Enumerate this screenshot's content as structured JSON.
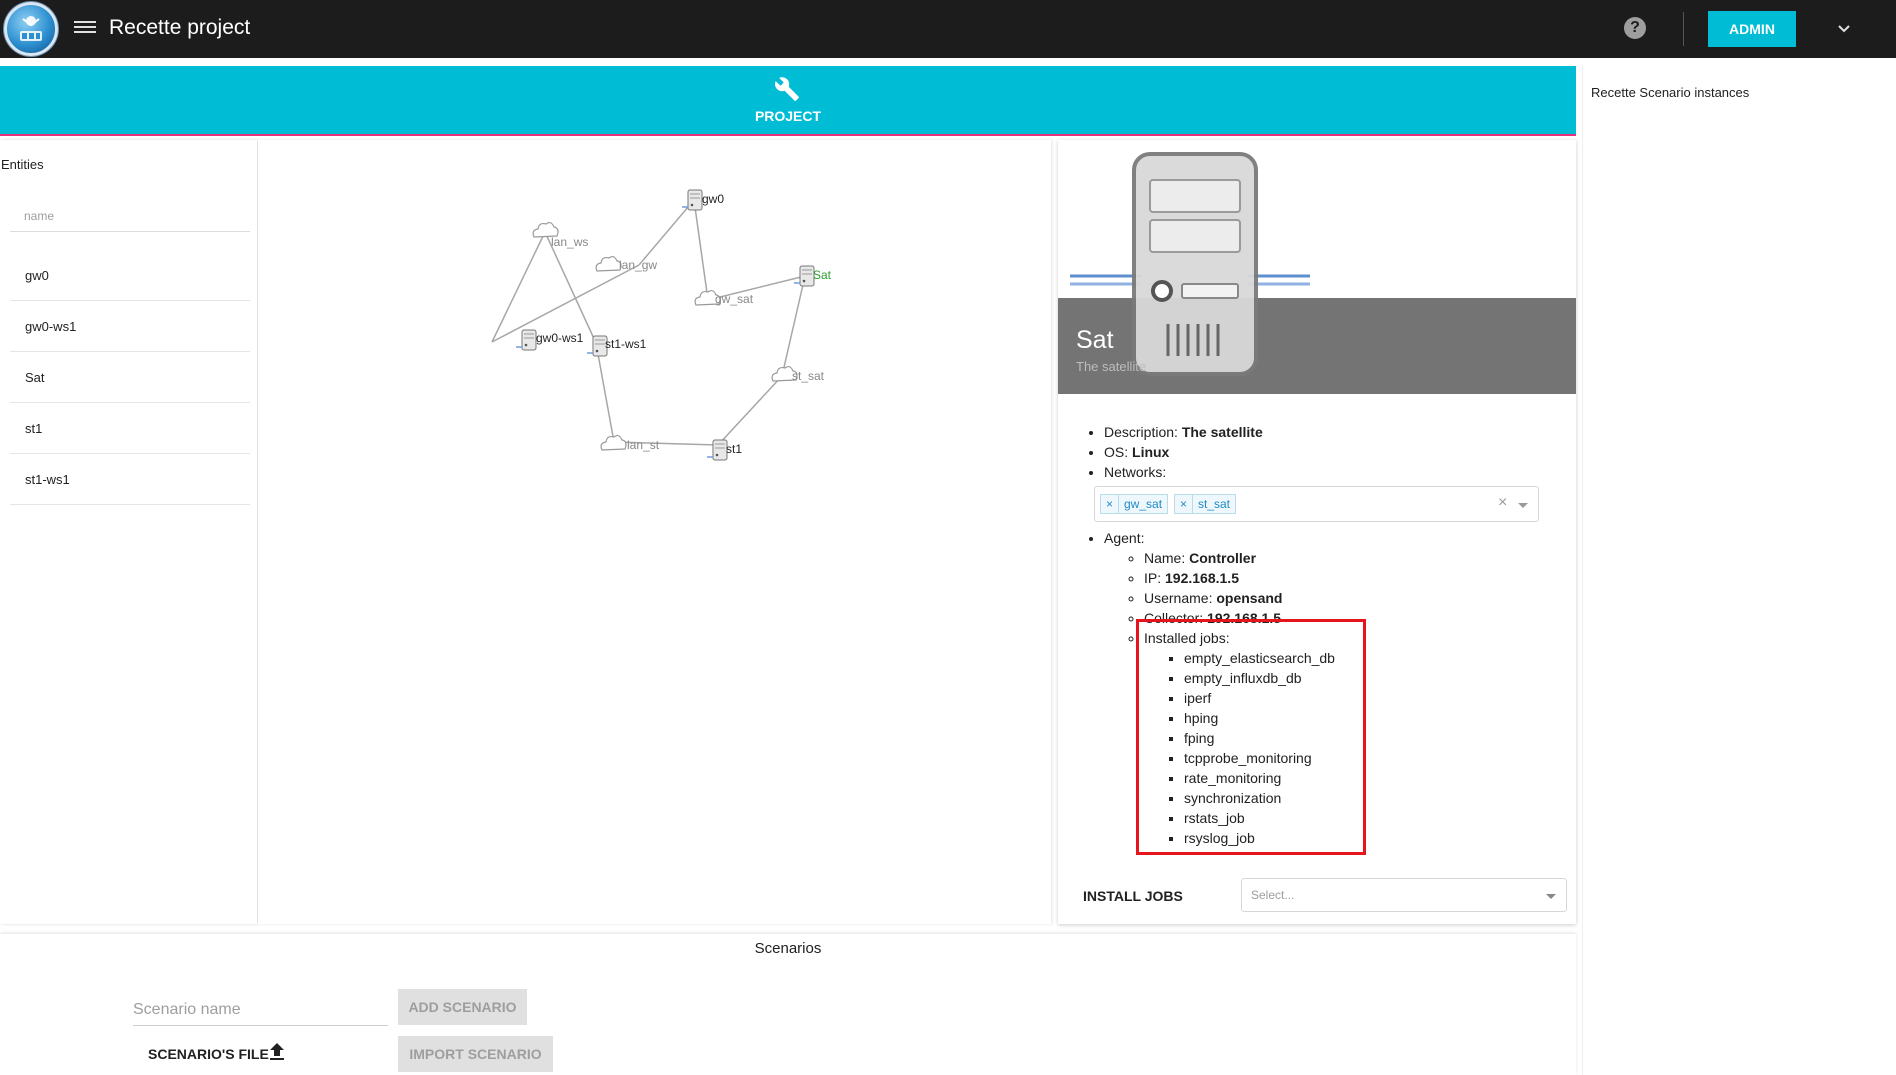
{
  "header": {
    "title": "Recette project",
    "help_label": "?",
    "admin_label": "ADMIN"
  },
  "banner": {
    "label": "PROJECT"
  },
  "right_sidebar": {
    "title": "Recette Scenario instances"
  },
  "entities": {
    "title": "Entities",
    "filter_placeholder": "name",
    "items": [
      "gw0",
      "gw0-ws1",
      "Sat",
      "st1",
      "st1-ws1"
    ]
  },
  "graph": {
    "entities": [
      "gw0",
      "gw0-ws1",
      "st1-ws1",
      "st1",
      "Sat"
    ],
    "networks": [
      "lan_ws",
      "lan_gw",
      "gw_sat",
      "st_sat",
      "lan_st"
    ]
  },
  "details": {
    "name": "Sat",
    "subtitle": "The satellite",
    "description_label": "Description:",
    "description": "The satellite",
    "os_label": "OS:",
    "os": "Linux",
    "networks_label": "Networks:",
    "networks": [
      "gw_sat",
      "st_sat"
    ],
    "chip_remove": "×",
    "clear_label": "×",
    "agent_label": "Agent:",
    "agent": {
      "name_label": "Name:",
      "name": "Controller",
      "ip_label": "IP:",
      "ip": "192.168.1.5",
      "username_label": "Username:",
      "username": "opensand",
      "collector_label": "Collector:",
      "collector": "192.168.1.5",
      "jobs_label": "Installed jobs:",
      "jobs": [
        "empty_elasticsearch_db",
        "empty_influxdb_db",
        "iperf",
        "hping",
        "fping",
        "tcpprobe_monitoring",
        "rate_monitoring",
        "synchronization",
        "rstats_job",
        "rsyslog_job"
      ]
    },
    "install_label": "INSTALL JOBS",
    "install_placeholder": "Select..."
  },
  "scenarios": {
    "title": "Scenarios",
    "name_placeholder": "Scenario name",
    "add_label": "ADD SCENARIO",
    "file_label": "SCENARIO'S FILE",
    "import_label": "IMPORT SCENARIO"
  },
  "colors": {
    "appbar": "#1c1c1c",
    "accent": "#00bcd4",
    "highlight": "#e5141d"
  }
}
